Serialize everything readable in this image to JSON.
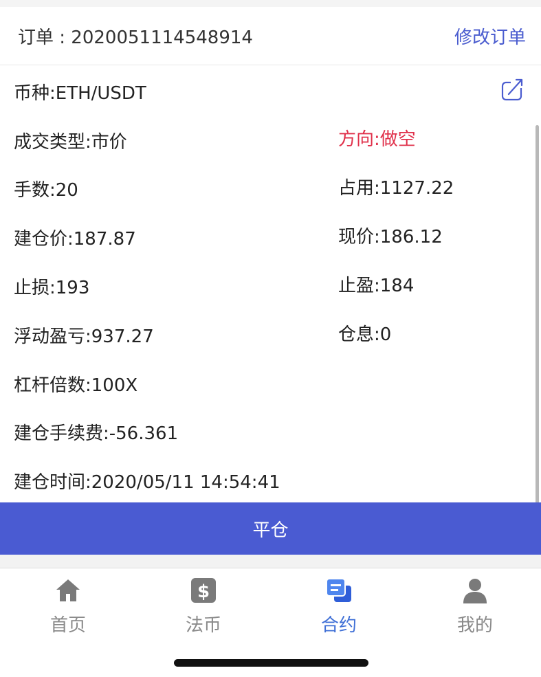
{
  "header": {
    "order_label": "订单 : 2020051114548914",
    "modify_label": "修改订单"
  },
  "details": {
    "symbol": "币种:ETH/USDT",
    "trade_type": "成交类型:市价",
    "direction": "方向:做空",
    "lots": "手数:20",
    "margin_used": "占用:1127.22",
    "open_price": "建仓价:187.87",
    "current_price": "现价:186.12",
    "stop_loss": "止损:193",
    "take_profit": "止盈:184",
    "floating_pnl": "浮动盈亏:937.27",
    "swap": "仓息:0",
    "leverage": "杠杆倍数:100X",
    "open_fee": "建仓手续费:-56.361",
    "open_time": "建仓时间:2020/05/11 14:54:41"
  },
  "actions": {
    "close_position": "平仓"
  },
  "tabbar": {
    "items": [
      {
        "label": "首页",
        "icon": "home-icon"
      },
      {
        "label": "法币",
        "icon": "dollar-icon"
      },
      {
        "label": "合约",
        "icon": "contract-icon",
        "active": true
      },
      {
        "label": "我的",
        "icon": "user-icon"
      }
    ]
  },
  "colors": {
    "accent": "#4a5bd2",
    "link": "#4a5ccf",
    "short_direction": "#e0304a",
    "active_tab": "#3f6fd6"
  }
}
